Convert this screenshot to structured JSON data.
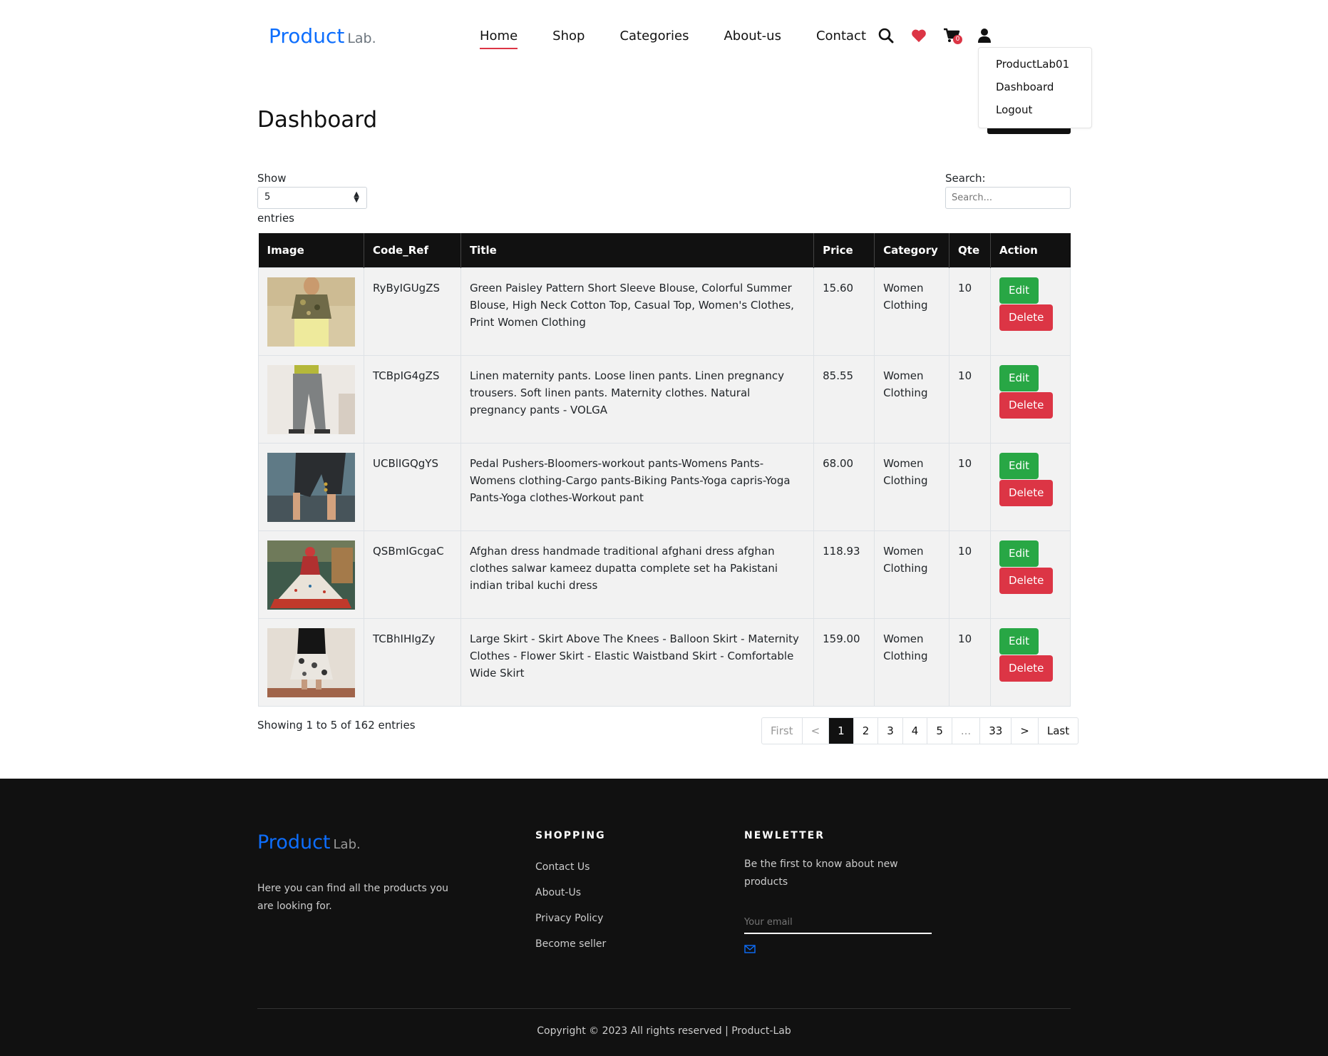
{
  "brand": {
    "name": "Product",
    "suffix": "Lab."
  },
  "nav": [
    {
      "label": "Home",
      "active": true
    },
    {
      "label": "Shop"
    },
    {
      "label": "Categories"
    },
    {
      "label": "About-us"
    },
    {
      "label": "Contact"
    }
  ],
  "header_icons": {
    "search": "search-icon",
    "wishlist": "heart-icon",
    "cart": "cart-icon",
    "cart_count": "0",
    "user": "user-icon"
  },
  "user_menu": {
    "username": "ProductLab01",
    "dashboard": "Dashboard",
    "logout": "Logout"
  },
  "page": {
    "title": "Dashboard"
  },
  "controls": {
    "show_label": "Show",
    "entries_value": "5",
    "entries_label": "entries",
    "search_label": "Search:",
    "search_placeholder": "Search..."
  },
  "table": {
    "columns": [
      "Image",
      "Code_Ref",
      "Title",
      "Price",
      "Category",
      "Qte",
      "Action"
    ],
    "edit_label": "Edit",
    "delete_label": "Delete",
    "rows": [
      {
        "code": "RyByIGUgZS",
        "title": "Green Paisley Pattern Short Sleeve Blouse, Colorful Summer Blouse, High Neck Cotton Top, Casual Top, Women's Clothes, Print Women Clothing",
        "price": "15.60",
        "category": "Women Clothing",
        "qte": "10"
      },
      {
        "code": "TCBpIG4gZS",
        "title": "Linen maternity pants. Loose linen pants. Linen pregnancy trousers. Soft linen pants. Maternity clothes. Natural pregnancy pants - VOLGA",
        "price": "85.55",
        "category": "Women Clothing",
        "qte": "10"
      },
      {
        "code": "UCBlIGQgYS",
        "title": "Pedal Pushers-Bloomers-workout pants-Womens Pants-Womens clothing-Cargo pants-Biking Pants-Yoga capris-Yoga Pants-Yoga clothes-Workout pant",
        "price": "68.00",
        "category": "Women Clothing",
        "qte": "10"
      },
      {
        "code": "QSBmIGcgaC",
        "title": "Afghan dress handmade traditional afghani dress afghan clothes salwar kameez dupatta complete set ha Pakistani indian tribal kuchi dress",
        "price": "118.93",
        "category": "Women Clothing",
        "qte": "10"
      },
      {
        "code": "TCBhIHIgZy",
        "title": "Large Skirt - Skirt Above The Knees - Balloon Skirt - Maternity Clothes - Flower Skirt - Elastic Waistband Skirt - Comfortable Wide Skirt",
        "price": "159.00",
        "category": "Women Clothing",
        "qte": "10"
      }
    ]
  },
  "summary": "Showing 1 to 5 of 162 entries",
  "pagination": [
    "First",
    "<",
    "1",
    "2",
    "3",
    "4",
    "5",
    "...",
    "33",
    ">",
    "Last"
  ],
  "footer": {
    "brand": "Product",
    "brand_suffix": "Lab.",
    "description": "Here you can find all the products you are looking for.",
    "shopping_heading": "SHOPPING",
    "shopping_links": [
      "Contact Us",
      "About-Us",
      "Privacy Policy",
      "Become seller"
    ],
    "newsletter_heading": "NEWLETTER",
    "newsletter_text": "Be the first to know about new products",
    "email_placeholder": "Your email",
    "copyright": "Copyright © 2023 All rights reserved | Product-Lab"
  },
  "colors": {
    "accent": "#0d6efd",
    "edit": "#28a745",
    "delete": "#dc3545",
    "dark": "#111111"
  }
}
